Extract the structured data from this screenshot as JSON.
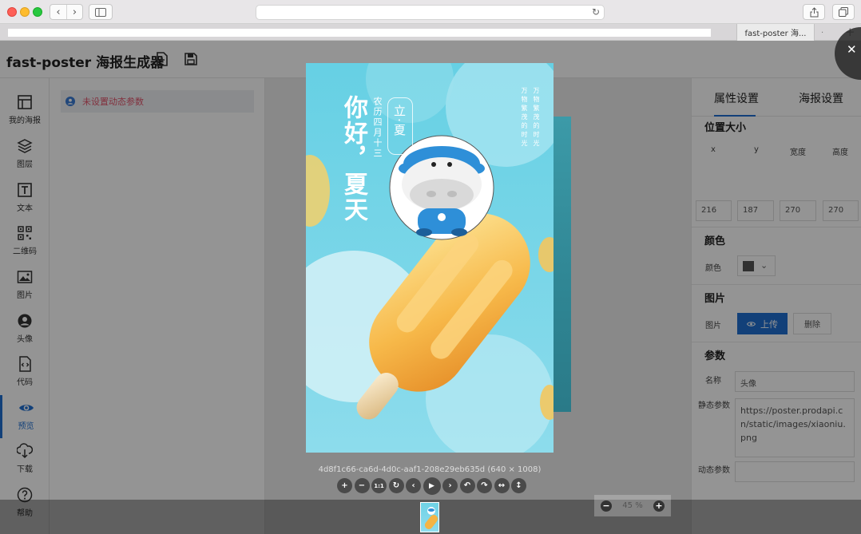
{
  "browser": {
    "tab_title": "fast-poster 海...",
    "tab_overflow": ".",
    "tab_add": "+"
  },
  "app": {
    "title": "fast-poster 海报生成器"
  },
  "nav": {
    "items": [
      {
        "label": "我的海报",
        "icon": "layout-icon"
      },
      {
        "label": "图层",
        "icon": "layers-icon"
      },
      {
        "label": "文本",
        "icon": "text-icon"
      },
      {
        "label": "二维码",
        "icon": "qrcode-icon"
      },
      {
        "label": "图片",
        "icon": "image-icon"
      },
      {
        "label": "头像",
        "icon": "avatar-icon"
      },
      {
        "label": "代码",
        "icon": "code-icon"
      },
      {
        "label": "预览",
        "icon": "eye-icon"
      },
      {
        "label": "下载",
        "icon": "download-icon"
      },
      {
        "label": "帮助",
        "icon": "help-icon"
      }
    ],
    "active_label": "预览"
  },
  "layer_panel": {
    "dynamic_param_warning": "未设置动态参数"
  },
  "right_panel": {
    "tab_properties": "属性设置",
    "tab_poster": "海报设置",
    "section_position": "位置大小",
    "col_x": "x",
    "col_y": "y",
    "col_width": "宽度",
    "col_height": "高度",
    "val_x": "216",
    "val_y": "187",
    "val_width": "270",
    "val_height": "270",
    "section_color": "颜色",
    "color_label": "颜色",
    "color_value": "#555555",
    "section_image": "图片",
    "image_label": "图片",
    "upload_label": "上传",
    "delete_label": "删除",
    "section_params": "参数",
    "name_label": "名称",
    "name_value": "头像",
    "static_label": "静态参数",
    "static_value": "https://poster.prodapi.cn/static/images/xiaoniu.png",
    "dynamic_label": "动态参数",
    "dynamic_value": ""
  },
  "preview": {
    "image_meta": "4d8f1c66-ca6d-4d0c-aaf1-208e29eb635d (640 × 1008)",
    "toolbar": [
      {
        "glyph": "+",
        "name": "zoom-in"
      },
      {
        "glyph": "−",
        "name": "zoom-out"
      },
      {
        "glyph": "1:1",
        "name": "one-to-one"
      },
      {
        "glyph": "↻",
        "name": "reset"
      },
      {
        "glyph": "‹",
        "name": "prev"
      },
      {
        "glyph": "▶",
        "name": "play"
      },
      {
        "glyph": "›",
        "name": "next"
      },
      {
        "glyph": "↶",
        "name": "rotate-left"
      },
      {
        "glyph": "↷",
        "name": "rotate-right"
      },
      {
        "glyph": "↔",
        "name": "flip-horizontal"
      },
      {
        "glyph": "↕",
        "name": "flip-vertical"
      }
    ],
    "zoom_text": "45 %",
    "poster": {
      "headline": "你好，夏天",
      "lunar_date": "农历四月十三",
      "lixia": "立·夏",
      "col1": "万物繁茂的时光",
      "col2": "万物繁茂的时光"
    }
  }
}
